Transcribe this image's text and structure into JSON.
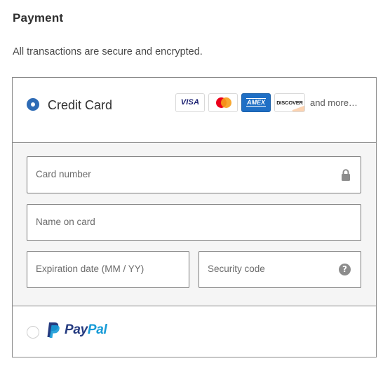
{
  "section": {
    "title": "Payment",
    "subtitle": "All transactions are secure and encrypted."
  },
  "credit_card": {
    "label": "Credit Card",
    "selected": true,
    "brands": [
      {
        "name": "VISA",
        "icon": "visa-icon"
      },
      {
        "name": "",
        "icon": "mastercard-icon"
      },
      {
        "name": "AMEX",
        "icon": "amex-icon"
      },
      {
        "name": "DISCOVER",
        "icon": "discover-icon"
      }
    ],
    "more_label": "and more…",
    "fields": {
      "card_number": {
        "placeholder": "Card number",
        "value": "",
        "icon": "lock-icon"
      },
      "name_on_card": {
        "placeholder": "Name on card",
        "value": ""
      },
      "expiration": {
        "placeholder": "Expiration date (MM / YY)",
        "value": ""
      },
      "security_code": {
        "placeholder": "Security code",
        "value": "",
        "icon": "help-icon",
        "icon_glyph": "?"
      }
    }
  },
  "paypal": {
    "label_pay": "Pay",
    "label_pal": "Pal",
    "selected": false
  },
  "colors": {
    "accent": "#2e6bb5",
    "paypal_dark": "#253b80",
    "paypal_light": "#179bd7",
    "panel_bg": "#f5f5f5",
    "border": "#8a8a8a"
  }
}
